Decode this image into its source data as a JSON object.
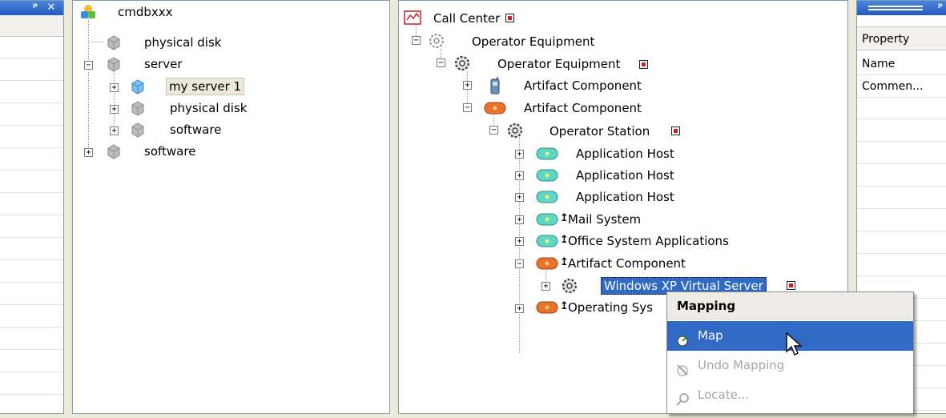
{
  "left_panel": {
    "title_buttons": {
      "pin": "ᵖ",
      "close": "✕"
    }
  },
  "tree1": {
    "nodes": [
      {
        "label": "cmdbxxx",
        "icon": "cmdb-root-icon"
      },
      {
        "label": "physical disk",
        "icon": "box-gray-icon"
      },
      {
        "label": "server",
        "icon": "box-gray-icon"
      },
      {
        "label": "my server 1",
        "icon": "box-blue-icon",
        "selected": true
      },
      {
        "label": "physical disk",
        "icon": "box-gray-icon"
      },
      {
        "label": "software",
        "icon": "box-gray-icon"
      },
      {
        "label": "software",
        "icon": "box-gray-icon"
      }
    ]
  },
  "tree2": {
    "nodes": [
      {
        "label": "Call Center",
        "icon": "call-center-icon"
      },
      {
        "label": "Operator Equipment",
        "icon": "gear-outline-icon"
      },
      {
        "label": "Operator Equipment",
        "icon": "gear-dark-icon"
      },
      {
        "label": "Artifact Component",
        "icon": "phone-icon"
      },
      {
        "label": "Artifact Component",
        "icon": "orange-pill-icon"
      },
      {
        "label": "Operator Station",
        "icon": "gear-dark-icon"
      },
      {
        "label": "Application Host",
        "icon": "teal-pill-icon"
      },
      {
        "label": "Application Host",
        "icon": "teal-pill-icon"
      },
      {
        "label": "Application Host",
        "icon": "teal-pill-icon"
      },
      {
        "label": "Mail System",
        "icon": "teal-pill-icon"
      },
      {
        "label": "Office System Applications",
        "icon": "teal-pill-icon"
      },
      {
        "label": "Artifact Component",
        "icon": "orange-pill-icon"
      },
      {
        "label": "Windows XP Virtual Server",
        "icon": "gear-dark-icon",
        "highlighted": true
      },
      {
        "label": "Operating Sys",
        "icon": "orange-pill-icon"
      }
    ]
  },
  "properties": {
    "header": "Property",
    "rows": [
      "Name",
      "Commen..."
    ]
  },
  "context_menu": {
    "header": "Mapping",
    "items": [
      {
        "label": "Map",
        "icon": "map-icon",
        "state": "active"
      },
      {
        "label": "Undo Mapping",
        "icon": "undo-mapping-icon",
        "state": "disabled"
      },
      {
        "label": "Locate...",
        "icon": "locate-icon",
        "state": "disabled"
      }
    ]
  },
  "colors": {
    "selection": "#316ac5",
    "title_bar": "#2459c4",
    "accent_orange": "#e8742a",
    "accent_teal": "#5fd6c6"
  }
}
